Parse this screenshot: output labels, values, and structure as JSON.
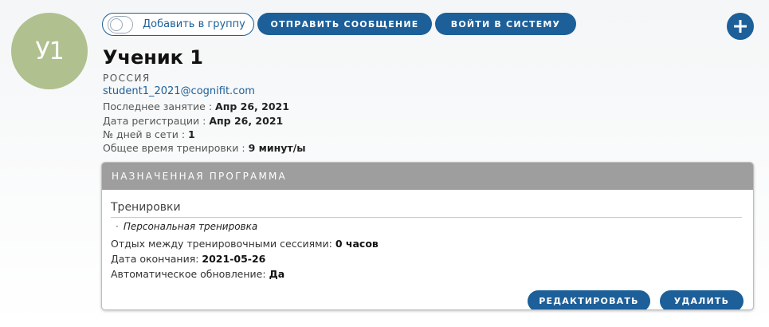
{
  "profile": {
    "initials": "У1",
    "name": "Ученик 1",
    "country": "РОССИЯ",
    "email": "student1_2021@cognifit.com",
    "last_session_label": "Последнее занятие : ",
    "last_session_value": "Апр 26, 2021",
    "registration_label": "Дата регистрации : ",
    "registration_value": "Апр 26, 2021",
    "days_online_label": "№ дней в сети : ",
    "days_online_value": "1",
    "total_time_label": "Общее время тренировки : ",
    "total_time_value": "9 минут/ы"
  },
  "actions": {
    "add_to_group": "Добавить в группу",
    "send_message": "ОТПРАВИТЬ СООБЩЕНИЕ",
    "login": "ВОЙТИ В СИСТЕМУ",
    "add_icon": "plus-icon"
  },
  "program": {
    "header": "НАЗНАЧЕННАЯ ПРОГРАММА",
    "section_title": "Тренировки",
    "training_item": "Персональная тренировка",
    "rest_label": "Отдых между тренировочными сессиями: ",
    "rest_value": "0 часов",
    "end_date_label": "Дата окончания: ",
    "end_date_value": "2021-05-26",
    "auto_renew_label": "Автоматическое обновление: ",
    "auto_renew_value": "Да",
    "edit_button": "РЕДАКТИРОВАТЬ",
    "delete_button": "УДАЛИТЬ"
  },
  "colors": {
    "primary": "#1c5f99",
    "avatar": "#b0c08e",
    "card_header": "#9e9e9e"
  }
}
